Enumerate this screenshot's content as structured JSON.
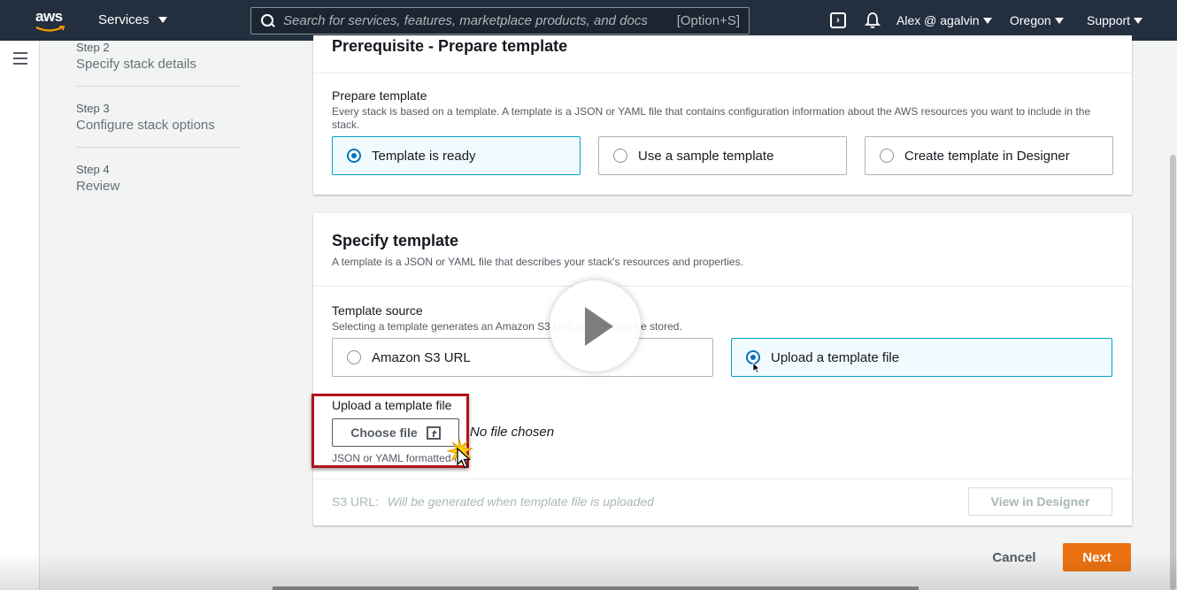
{
  "nav": {
    "logo": "aws",
    "services": "Services",
    "search_placeholder": "Search for services, features, marketplace products, and docs",
    "search_shortcut": "[Option+S]",
    "user": "Alex @ agalvin",
    "region": "Oregon",
    "support": "Support"
  },
  "steps": [
    {
      "num": "Step 2",
      "title": "Specify stack details"
    },
    {
      "num": "Step 3",
      "title": "Configure stack options"
    },
    {
      "num": "Step 4",
      "title": "Review"
    }
  ],
  "prereq": {
    "heading": "Prerequisite - Prepare template",
    "field_label": "Prepare template",
    "field_desc": "Every stack is based on a template. A template is a JSON or YAML file that contains configuration information about the AWS resources you want to include in the stack.",
    "options": [
      "Template is ready",
      "Use a sample template",
      "Create template in Designer"
    ],
    "selected": "Template is ready"
  },
  "specify": {
    "heading": "Specify template",
    "desc": "A template is a JSON or YAML file that describes your stack's resources and properties.",
    "source_label": "Template source",
    "source_desc": "Selecting a template generates an Amazon S3 URL where it will be stored.",
    "source_options": [
      "Amazon S3 URL",
      "Upload a template file"
    ],
    "source_selected": "Upload a template file",
    "upload_label": "Upload a template file",
    "choose_file": "Choose file",
    "no_file": "No file chosen",
    "hint": "JSON or YAML formatted file",
    "s3_url_label": "S3 URL:",
    "s3_url_value": "Will be generated when template file is uploaded",
    "view_designer": "View in Designer"
  },
  "footer": {
    "cancel": "Cancel",
    "next": "Next"
  },
  "colors": {
    "nav_bg": "#232f3e",
    "selected_border": "#00a1c9",
    "primary": "#ec7211",
    "highlight": "#b0141a"
  }
}
